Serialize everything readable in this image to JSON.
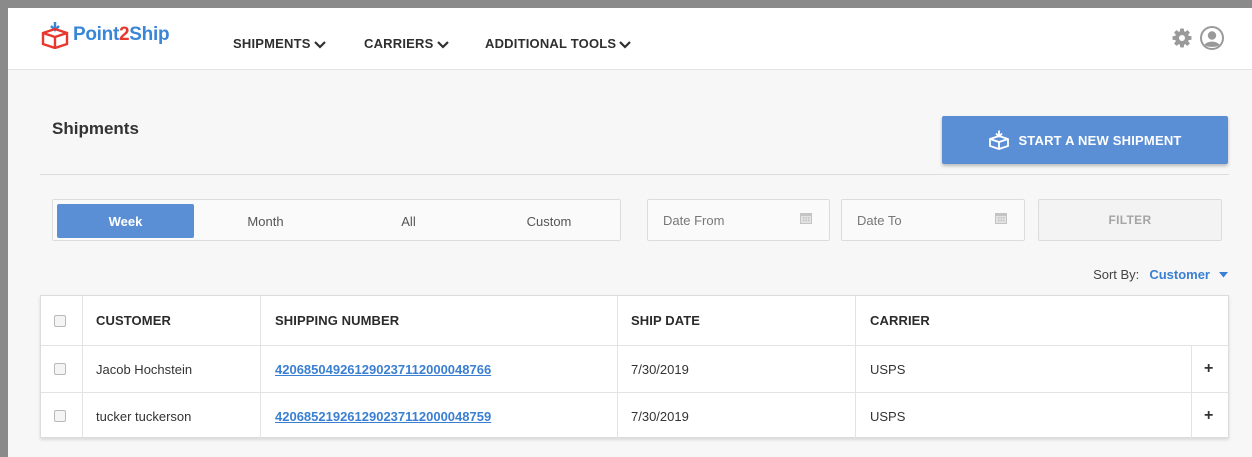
{
  "app": {
    "brand_left": "Point",
    "brand_two": "2",
    "brand_right": "Ship"
  },
  "nav": {
    "items": [
      {
        "label": "SHIPMENTS"
      },
      {
        "label": "CARRIERS"
      },
      {
        "label": "ADDITIONAL TOOLS"
      }
    ]
  },
  "header_icons": [
    "gear-icon",
    "user-avatar-icon"
  ],
  "page": {
    "title": "Shipments",
    "new_shipment_label": "START A NEW SHIPMENT"
  },
  "filters": {
    "periods": [
      {
        "label": "Week",
        "active": true
      },
      {
        "label": "Month",
        "active": false
      },
      {
        "label": "All",
        "active": false
      },
      {
        "label": "Custom",
        "active": false
      }
    ],
    "date_from_placeholder": "Date From",
    "date_to_placeholder": "Date To",
    "filter_label": "FILTER"
  },
  "sort": {
    "label": "Sort By:",
    "value": "Customer"
  },
  "table": {
    "columns": [
      "CUSTOMER",
      "SHIPPING NUMBER",
      "SHIP DATE",
      "CARRIER"
    ],
    "rows": [
      {
        "customer": "Jacob Hochstein",
        "shipping_number": "420685049261290237112000048766",
        "ship_date": "7/30/2019",
        "carrier": "USPS",
        "expand": "+"
      },
      {
        "customer": "tucker tuckerson",
        "shipping_number": "420685219261290237112000048759",
        "ship_date": "7/30/2019",
        "carrier": "USPS",
        "expand": "+"
      }
    ]
  },
  "colors": {
    "accent": "#5a8fd6",
    "link": "#3a7fd2",
    "brand_red": "#e8372f",
    "brand_blue": "#3a86d6"
  }
}
